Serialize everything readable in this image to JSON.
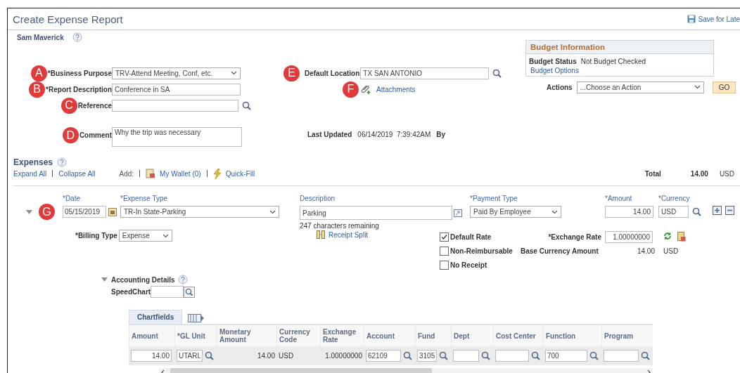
{
  "header": {
    "title": "Create Expense Report",
    "save_link": "Save for Late",
    "employee": "Sam Maverick"
  },
  "report_fields": [
    {
      "marker": "A",
      "label": "*Business Purpose",
      "kind": "select",
      "value": "TRV-Attend Meeting, Conf, etc."
    },
    {
      "marker": "B",
      "label": "*Report Description",
      "kind": "text",
      "value": "Conference in SA"
    },
    {
      "marker": "C",
      "label": "Reference",
      "kind": "lookup"
    },
    {
      "marker": "D",
      "label": "Comment",
      "kind": "textarea",
      "value": "Why the trip was necessary"
    }
  ],
  "location": {
    "marker": "E",
    "label": "Default Location",
    "value": "TX SAN ANTONIO"
  },
  "attachments": {
    "marker": "F",
    "link": "Attachments"
  },
  "last_updated": {
    "label": "Last Updated",
    "value": "06/14/2019  7:39:42AM",
    "by": "By"
  },
  "budget": {
    "title": "Budget Information",
    "status_label": "Budget Status",
    "status": "Not Budget Checked",
    "options_link": "Budget Options"
  },
  "actions": {
    "label": "Actions",
    "value": "...Choose an Action",
    "button": "GO"
  },
  "expenses": {
    "title": "Expenses",
    "expand_all": "Expand All",
    "collapse_all": "Collapse All",
    "add_label": "Add:",
    "wallet": "My Wallet (0)",
    "quick_fill": "Quick-Fill",
    "total_label": "Total",
    "total": "14.00",
    "total_currency": "USD"
  },
  "line": {
    "marker": "G",
    "expanded": true,
    "date_label": "*Date",
    "date": "05/15/2019",
    "type_label": "*Expense Type",
    "type": "TR-In State-Parking",
    "description_label": "Description",
    "description": "Parking",
    "remaining": "247 characters remaining",
    "receipt_split": "Receipt Split",
    "payment_label": "*Payment Type",
    "payment": "Paid By Employee",
    "amount_label": "*Amount",
    "amount": "14.00",
    "currency_label": "*Currency",
    "currency": "USD",
    "billing_label": "*Billing Type",
    "billing": "Expense",
    "rate_label": "*Exchange Rate",
    "rate": "1.00000000",
    "base_label": "Base Currency Amount",
    "base_amount": "14.00",
    "base_currency": "USD",
    "options": [
      {
        "label": "Default Rate",
        "checked": true
      },
      {
        "label": "Non-Reimbursable",
        "checked": false
      },
      {
        "label": "No Receipt",
        "checked": false
      }
    ]
  },
  "accounting": {
    "title": "Accounting Details",
    "expanded": true,
    "speedchart_label": "SpeedChart",
    "tabs": [
      {
        "label": "Chartfields",
        "selected": true
      }
    ],
    "columns": [
      "Amount",
      "*GL Unit",
      "Monetary Amount",
      "Currency Code",
      "Exchange Rate",
      "Account",
      "Fund",
      "Dept",
      "Cost Center",
      "Function",
      "Program"
    ],
    "rows": [
      {
        "cells": [
          {
            "kind": "input",
            "value": "14.00"
          },
          {
            "kind": "lookup",
            "value": "UTARL"
          },
          {
            "kind": "number",
            "value": "14.00"
          },
          {
            "kind": "text",
            "value": "USD"
          },
          {
            "kind": "number",
            "value": "1.00000000"
          },
          {
            "kind": "lookup",
            "value": "62109"
          },
          {
            "kind": "lookup",
            "value": "3105"
          },
          {
            "kind": "lookup"
          },
          {
            "kind": "lookup"
          },
          {
            "kind": "lookup",
            "value": "700"
          },
          {
            "kind": "lookup"
          }
        ]
      }
    ]
  }
}
